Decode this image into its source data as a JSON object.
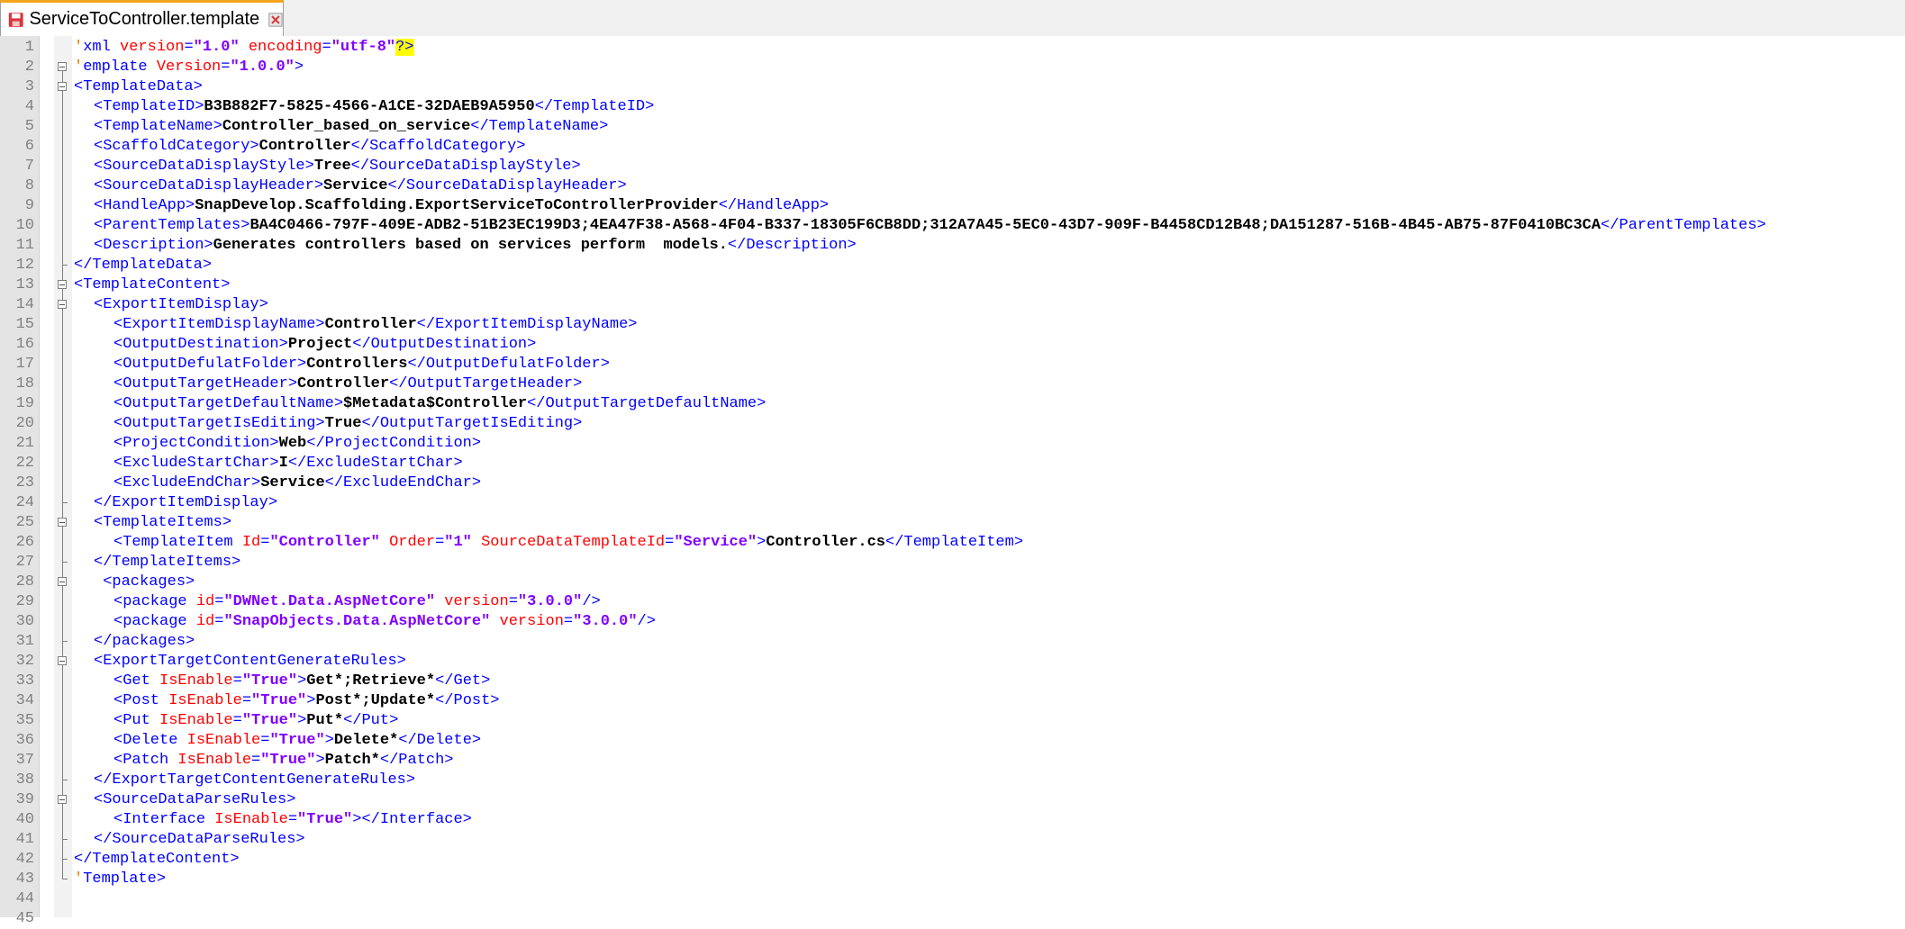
{
  "tab": {
    "filename": "ServiceToController.template",
    "save_icon": "floppy-disk-icon",
    "close_icon": "close-icon"
  },
  "editor": {
    "lines": [
      {
        "n": "1",
        "i": 0,
        "f": "",
        "s": [
          {
            "c": "caret-mark",
            "t": "'"
          },
          {
            "c": "t",
            "t": "xml "
          },
          {
            "c": "a",
            "t": "version"
          },
          {
            "c": "t",
            "t": "="
          },
          {
            "c": "v",
            "t": "\"1.0\""
          },
          {
            "c": "t",
            "t": " "
          },
          {
            "c": "a",
            "t": "encoding"
          },
          {
            "c": "t",
            "t": "="
          },
          {
            "c": "v",
            "t": "\"utf-8\""
          },
          {
            "c": "hl t",
            "t": "?>"
          }
        ]
      },
      {
        "n": "2",
        "i": 0,
        "f": "open",
        "s": [
          {
            "c": "caret-mark",
            "t": "'"
          },
          {
            "c": "t",
            "t": "emplate "
          },
          {
            "c": "a",
            "t": "Version"
          },
          {
            "c": "t",
            "t": "="
          },
          {
            "c": "v",
            "t": "\"1.0.0\""
          },
          {
            "c": "t",
            "t": ">"
          }
        ]
      },
      {
        "n": "3",
        "i": 0,
        "f": "open",
        "s": [
          {
            "c": "t",
            "t": "<TemplateData>"
          }
        ]
      },
      {
        "n": "4",
        "i": 1,
        "f": "line",
        "s": [
          {
            "c": "t",
            "t": "<TemplateID>"
          },
          {
            "c": "x",
            "t": "B3B882F7-5825-4566-A1CE-32DAEB9A5950"
          },
          {
            "c": "t",
            "t": "</TemplateID>"
          }
        ]
      },
      {
        "n": "5",
        "i": 1,
        "f": "line",
        "s": [
          {
            "c": "t",
            "t": "<TemplateName>"
          },
          {
            "c": "x",
            "t": "Controller_based_on_service"
          },
          {
            "c": "t",
            "t": "</TemplateName>"
          }
        ]
      },
      {
        "n": "6",
        "i": 1,
        "f": "line",
        "s": [
          {
            "c": "t",
            "t": "<ScaffoldCategory>"
          },
          {
            "c": "x",
            "t": "Controller"
          },
          {
            "c": "t",
            "t": "</ScaffoldCategory>"
          }
        ]
      },
      {
        "n": "7",
        "i": 1,
        "f": "line",
        "s": [
          {
            "c": "t",
            "t": "<SourceDataDisplayStyle>"
          },
          {
            "c": "x",
            "t": "Tree"
          },
          {
            "c": "t",
            "t": "</SourceDataDisplayStyle>"
          }
        ]
      },
      {
        "n": "8",
        "i": 1,
        "f": "line",
        "s": [
          {
            "c": "t",
            "t": "<SourceDataDisplayHeader>"
          },
          {
            "c": "x",
            "t": "Service"
          },
          {
            "c": "t",
            "t": "</SourceDataDisplayHeader>"
          }
        ]
      },
      {
        "n": "9",
        "i": 1,
        "f": "line",
        "s": [
          {
            "c": "t",
            "t": "<HandleApp>"
          },
          {
            "c": "x",
            "t": "SnapDevelop.Scaffolding.ExportServiceToControllerProvider"
          },
          {
            "c": "t",
            "t": "</HandleApp>"
          }
        ]
      },
      {
        "n": "10",
        "i": 1,
        "f": "line",
        "s": [
          {
            "c": "t",
            "t": "<ParentTemplates>"
          },
          {
            "c": "x",
            "t": "BA4C0466-797F-409E-ADB2-51B23EC199D3;4EA47F38-A568-4F04-B337-18305F6CB8DD;312A7A45-5EC0-43D7-909F-B4458CD12B48;DA151287-516B-4B45-AB75-87F0410BC3CA"
          },
          {
            "c": "t",
            "t": "</ParentTemplates>"
          }
        ]
      },
      {
        "n": "11",
        "i": 1,
        "f": "line",
        "s": [
          {
            "c": "t",
            "t": "<Description>"
          },
          {
            "c": "x",
            "t": "Generates controllers based on services perform  models."
          },
          {
            "c": "t",
            "t": "</Description>"
          }
        ]
      },
      {
        "n": "12",
        "i": 0,
        "f": "end",
        "s": [
          {
            "c": "t",
            "t": "</TemplateData>"
          }
        ]
      },
      {
        "n": "13",
        "i": 0,
        "f": "open",
        "s": [
          {
            "c": "t",
            "t": "<TemplateContent>"
          }
        ]
      },
      {
        "n": "14",
        "i": 1,
        "f": "open",
        "s": [
          {
            "c": "t",
            "t": "<ExportItemDisplay>"
          }
        ]
      },
      {
        "n": "15",
        "i": 2,
        "f": "line",
        "s": [
          {
            "c": "t",
            "t": "<ExportItemDisplayName>"
          },
          {
            "c": "x",
            "t": "Controller"
          },
          {
            "c": "t",
            "t": "</ExportItemDisplayName>"
          }
        ]
      },
      {
        "n": "16",
        "i": 2,
        "f": "line",
        "s": [
          {
            "c": "t",
            "t": "<OutputDestination>"
          },
          {
            "c": "x",
            "t": "Project"
          },
          {
            "c": "t",
            "t": "</OutputDestination>"
          }
        ]
      },
      {
        "n": "17",
        "i": 2,
        "f": "line",
        "s": [
          {
            "c": "t",
            "t": "<OutputDefulatFolder>"
          },
          {
            "c": "x",
            "t": "Controllers"
          },
          {
            "c": "t",
            "t": "</OutputDefulatFolder>"
          }
        ]
      },
      {
        "n": "18",
        "i": 2,
        "f": "line",
        "s": [
          {
            "c": "t",
            "t": "<OutputTargetHeader>"
          },
          {
            "c": "x",
            "t": "Controller"
          },
          {
            "c": "t",
            "t": "</OutputTargetHeader>"
          }
        ]
      },
      {
        "n": "19",
        "i": 2,
        "f": "line",
        "s": [
          {
            "c": "t",
            "t": "<OutputTargetDefaultName>"
          },
          {
            "c": "x",
            "t": "$Metadata$Controller"
          },
          {
            "c": "t",
            "t": "</OutputTargetDefaultName>"
          }
        ]
      },
      {
        "n": "20",
        "i": 2,
        "f": "line",
        "s": [
          {
            "c": "t",
            "t": "<OutputTargetIsEditing>"
          },
          {
            "c": "x",
            "t": "True"
          },
          {
            "c": "t",
            "t": "</OutputTargetIsEditing>"
          }
        ]
      },
      {
        "n": "21",
        "i": 2,
        "f": "line",
        "s": [
          {
            "c": "t",
            "t": "<ProjectCondition>"
          },
          {
            "c": "x",
            "t": "Web"
          },
          {
            "c": "t",
            "t": "</ProjectCondition>"
          }
        ]
      },
      {
        "n": "22",
        "i": 2,
        "f": "line",
        "s": [
          {
            "c": "t",
            "t": "<ExcludeStartChar>"
          },
          {
            "c": "x",
            "t": "I"
          },
          {
            "c": "t",
            "t": "</ExcludeStartChar>"
          }
        ]
      },
      {
        "n": "23",
        "i": 2,
        "f": "line",
        "s": [
          {
            "c": "t",
            "t": "<ExcludeEndChar>"
          },
          {
            "c": "x",
            "t": "Service"
          },
          {
            "c": "t",
            "t": "</ExcludeEndChar>"
          }
        ]
      },
      {
        "n": "24",
        "i": 1,
        "f": "end",
        "s": [
          {
            "c": "t",
            "t": "</ExportItemDisplay>"
          }
        ]
      },
      {
        "n": "25",
        "i": 1,
        "f": "open",
        "s": [
          {
            "c": "t",
            "t": "<TemplateItems>"
          }
        ]
      },
      {
        "n": "26",
        "i": 2,
        "f": "line",
        "s": [
          {
            "c": "t",
            "t": "<TemplateItem "
          },
          {
            "c": "a",
            "t": "Id"
          },
          {
            "c": "t",
            "t": "="
          },
          {
            "c": "v",
            "t": "\"Controller\""
          },
          {
            "c": "t",
            "t": " "
          },
          {
            "c": "a",
            "t": "Order"
          },
          {
            "c": "t",
            "t": "="
          },
          {
            "c": "v",
            "t": "\"1\""
          },
          {
            "c": "t",
            "t": " "
          },
          {
            "c": "a",
            "t": "SourceDataTemplateId"
          },
          {
            "c": "t",
            "t": "="
          },
          {
            "c": "v",
            "t": "\"Service\""
          },
          {
            "c": "t",
            "t": ">"
          },
          {
            "c": "x",
            "t": "Controller.cs"
          },
          {
            "c": "t",
            "t": "</TemplateItem>"
          }
        ]
      },
      {
        "n": "27",
        "i": 1,
        "f": "end",
        "s": [
          {
            "c": "t",
            "t": "</TemplateItems>"
          }
        ]
      },
      {
        "n": "28",
        "i": 1,
        "f": "open",
        "s": [
          {
            "c": "t",
            "t": " <packages>"
          }
        ]
      },
      {
        "n": "29",
        "i": 2,
        "f": "line",
        "s": [
          {
            "c": "t",
            "t": "<package "
          },
          {
            "c": "a",
            "t": "id"
          },
          {
            "c": "t",
            "t": "="
          },
          {
            "c": "v",
            "t": "\"DWNet.Data.AspNetCore\""
          },
          {
            "c": "t",
            "t": " "
          },
          {
            "c": "a",
            "t": "version"
          },
          {
            "c": "t",
            "t": "="
          },
          {
            "c": "v",
            "t": "\"3.0.0\""
          },
          {
            "c": "t",
            "t": "/>"
          }
        ]
      },
      {
        "n": "30",
        "i": 2,
        "f": "line",
        "s": [
          {
            "c": "t",
            "t": "<package "
          },
          {
            "c": "a",
            "t": "id"
          },
          {
            "c": "t",
            "t": "="
          },
          {
            "c": "v",
            "t": "\"SnapObjects.Data.AspNetCore\""
          },
          {
            "c": "t",
            "t": " "
          },
          {
            "c": "a",
            "t": "version"
          },
          {
            "c": "t",
            "t": "="
          },
          {
            "c": "v",
            "t": "\"3.0.0\""
          },
          {
            "c": "t",
            "t": "/>"
          }
        ]
      },
      {
        "n": "31",
        "i": 1,
        "f": "end",
        "s": [
          {
            "c": "t",
            "t": "</packages>"
          }
        ]
      },
      {
        "n": "32",
        "i": 1,
        "f": "open",
        "s": [
          {
            "c": "t",
            "t": "<ExportTargetContentGenerateRules>"
          }
        ]
      },
      {
        "n": "33",
        "i": 2,
        "f": "line",
        "s": [
          {
            "c": "t",
            "t": "<Get "
          },
          {
            "c": "a",
            "t": "IsEnable"
          },
          {
            "c": "t",
            "t": "="
          },
          {
            "c": "v",
            "t": "\"True\""
          },
          {
            "c": "t",
            "t": ">"
          },
          {
            "c": "x",
            "t": "Get*;Retrieve*"
          },
          {
            "c": "t",
            "t": "</Get>"
          }
        ]
      },
      {
        "n": "34",
        "i": 2,
        "f": "line",
        "s": [
          {
            "c": "t",
            "t": "<Post "
          },
          {
            "c": "a",
            "t": "IsEnable"
          },
          {
            "c": "t",
            "t": "="
          },
          {
            "c": "v",
            "t": "\"True\""
          },
          {
            "c": "t",
            "t": ">"
          },
          {
            "c": "x",
            "t": "Post*;Update*"
          },
          {
            "c": "t",
            "t": "</Post>"
          }
        ]
      },
      {
        "n": "35",
        "i": 2,
        "f": "line",
        "s": [
          {
            "c": "t",
            "t": "<Put "
          },
          {
            "c": "a",
            "t": "IsEnable"
          },
          {
            "c": "t",
            "t": "="
          },
          {
            "c": "v",
            "t": "\"True\""
          },
          {
            "c": "t",
            "t": ">"
          },
          {
            "c": "x",
            "t": "Put*"
          },
          {
            "c": "t",
            "t": "</Put>"
          }
        ]
      },
      {
        "n": "36",
        "i": 2,
        "f": "line",
        "s": [
          {
            "c": "t",
            "t": "<Delete "
          },
          {
            "c": "a",
            "t": "IsEnable"
          },
          {
            "c": "t",
            "t": "="
          },
          {
            "c": "v",
            "t": "\"True\""
          },
          {
            "c": "t",
            "t": ">"
          },
          {
            "c": "x",
            "t": "Delete*"
          },
          {
            "c": "t",
            "t": "</Delete>"
          }
        ]
      },
      {
        "n": "37",
        "i": 2,
        "f": "line",
        "s": [
          {
            "c": "t",
            "t": "<Patch "
          },
          {
            "c": "a",
            "t": "IsEnable"
          },
          {
            "c": "t",
            "t": "="
          },
          {
            "c": "v",
            "t": "\"True\""
          },
          {
            "c": "t",
            "t": ">"
          },
          {
            "c": "x",
            "t": "Patch*"
          },
          {
            "c": "t",
            "t": "</Patch>"
          }
        ]
      },
      {
        "n": "38",
        "i": 1,
        "f": "end",
        "s": [
          {
            "c": "t",
            "t": "</ExportTargetContentGenerateRules>"
          }
        ]
      },
      {
        "n": "39",
        "i": 1,
        "f": "open",
        "s": [
          {
            "c": "t",
            "t": "<SourceDataParseRules>"
          }
        ]
      },
      {
        "n": "40",
        "i": 2,
        "f": "line",
        "s": [
          {
            "c": "t",
            "t": "<Interface "
          },
          {
            "c": "a",
            "t": "IsEnable"
          },
          {
            "c": "t",
            "t": "="
          },
          {
            "c": "v",
            "t": "\"True\""
          },
          {
            "c": "t",
            "t": "></Interface>"
          }
        ]
      },
      {
        "n": "41",
        "i": 1,
        "f": "end",
        "s": [
          {
            "c": "t",
            "t": "</SourceDataParseRules>"
          }
        ]
      },
      {
        "n": "42",
        "i": 0,
        "f": "end",
        "s": [
          {
            "c": "t",
            "t": "</TemplateContent>"
          }
        ]
      },
      {
        "n": "43",
        "i": 0,
        "f": "end",
        "s": [
          {
            "c": "caret-mark",
            "t": "'"
          },
          {
            "c": "t",
            "t": "Template>"
          }
        ]
      },
      {
        "n": "44",
        "i": 0,
        "f": "",
        "s": []
      },
      {
        "n": "45",
        "i": 0,
        "f": "",
        "s": []
      }
    ]
  }
}
